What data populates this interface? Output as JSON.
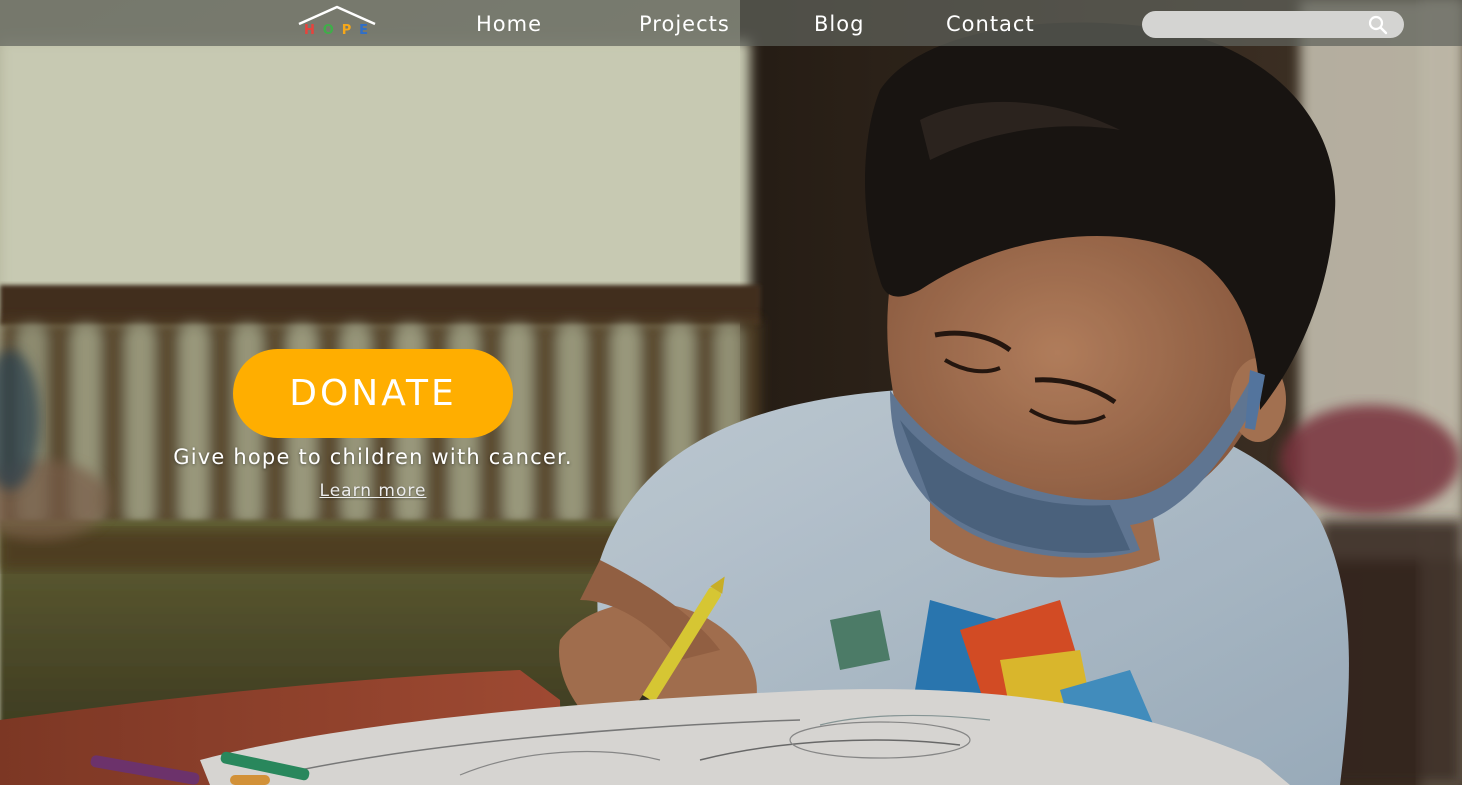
{
  "brand": {
    "logo_letters": [
      "H",
      "O",
      "P",
      "E"
    ],
    "logo_colors": [
      "#e8423c",
      "#3fae49",
      "#f6a81a",
      "#2f6fc9"
    ]
  },
  "nav": {
    "items": [
      {
        "label": "Home"
      },
      {
        "label": "Projects"
      },
      {
        "label": "Blog"
      },
      {
        "label": "Contact"
      }
    ]
  },
  "search": {
    "placeholder": "",
    "value": "",
    "icon": "search-icon"
  },
  "hero": {
    "background_image": "child-coloring-photo",
    "cta_label": "DONATE",
    "tagline": "Give hope to children with cancer.",
    "learn_more_label": "Learn more"
  },
  "colors": {
    "accent": "#ffae00",
    "header_bg": "#5f625c",
    "text_light": "#ffffff"
  }
}
